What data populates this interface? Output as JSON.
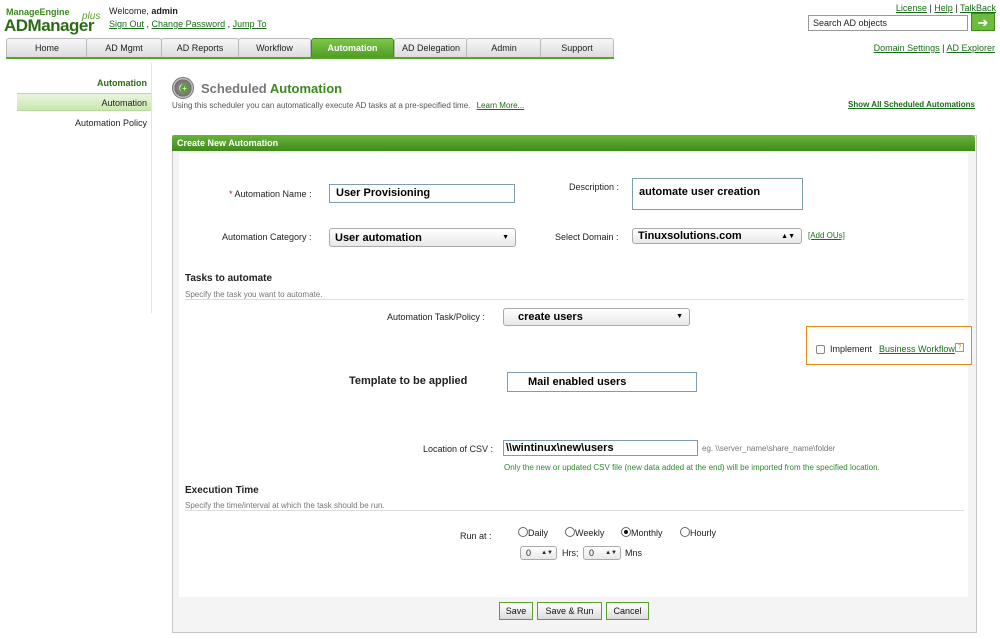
{
  "brand": {
    "top": "ManageEngine",
    "name": "ADManager",
    "plus": "plus"
  },
  "user": {
    "welcome": "Welcome,",
    "name": "admin",
    "sign_out": "Sign Out",
    "change_password": "Change Password",
    "jump_to": "Jump To"
  },
  "top_links": {
    "license": "License",
    "help": "Help",
    "talkback": "TalkBack"
  },
  "search": {
    "placeholder": "Search AD objects"
  },
  "tabs": [
    {
      "label": "Home"
    },
    {
      "label": "AD Mgmt"
    },
    {
      "label": "AD Reports"
    },
    {
      "label": "Workflow"
    },
    {
      "label": "Automation"
    },
    {
      "label": "AD Delegation"
    },
    {
      "label": "Admin"
    },
    {
      "label": "Support"
    }
  ],
  "right_links": {
    "domain_settings": "Domain Settings",
    "ad_explorer": "AD Explorer"
  },
  "sidebar": {
    "heading": "Automation",
    "items": [
      {
        "label": "Automation"
      },
      {
        "label": "Automation Policy"
      }
    ]
  },
  "page": {
    "title_prefix": "Scheduled",
    "title_main": "Automation",
    "subtitle": "Using this scheduler you can automatically execute AD tasks at a pre-specified time.",
    "learn_more": "Learn More...",
    "show_all": "Show All Scheduled Automations"
  },
  "form": {
    "header": "Create New Automation",
    "required_mark": "*",
    "name_label": "Automation Name :",
    "name_value": "User Provisioning",
    "description_label": "Description :",
    "description_value": "automate user creation",
    "category_label": "Automation Category :",
    "category_value": "User automation",
    "domain_label": "Select Domain :",
    "domain_value": "Tinuxsolutions.com",
    "add_ous": "[Add OUs]",
    "tasks_title": "Tasks to automate",
    "tasks_sub": "Specify the task you want to automate.",
    "task_label": "Automation Task/Policy :",
    "task_value": "create users",
    "implement_label": "Implement",
    "business_workflow": "Business Workflow",
    "help_icon_text": "?",
    "template_label": "Template to be applied",
    "template_value": "Mail enabled users",
    "csv_label": "Location of CSV :",
    "csv_value": "\\\\wintinux\\new\\users",
    "csv_hint": "eg. \\\\server_name\\share_name\\folder",
    "csv_note": "Only the new or updated CSV file (new data added at the end) will be imported from the specified location.",
    "exec_title": "Execution Time",
    "exec_sub": "Specify the time/interval at which the task should be run.",
    "run_at_label": "Run at :",
    "radios": [
      {
        "label": "Daily",
        "checked": false
      },
      {
        "label": "Weekly",
        "checked": false
      },
      {
        "label": "Monthly",
        "checked": true
      },
      {
        "label": "Hourly",
        "checked": false
      }
    ],
    "hrs_value": "0",
    "hrs_label": "Hrs;",
    "mins_value": "0",
    "mins_label": "Mns"
  },
  "buttons": {
    "save": "Save",
    "save_run": "Save & Run",
    "cancel": "Cancel"
  }
}
